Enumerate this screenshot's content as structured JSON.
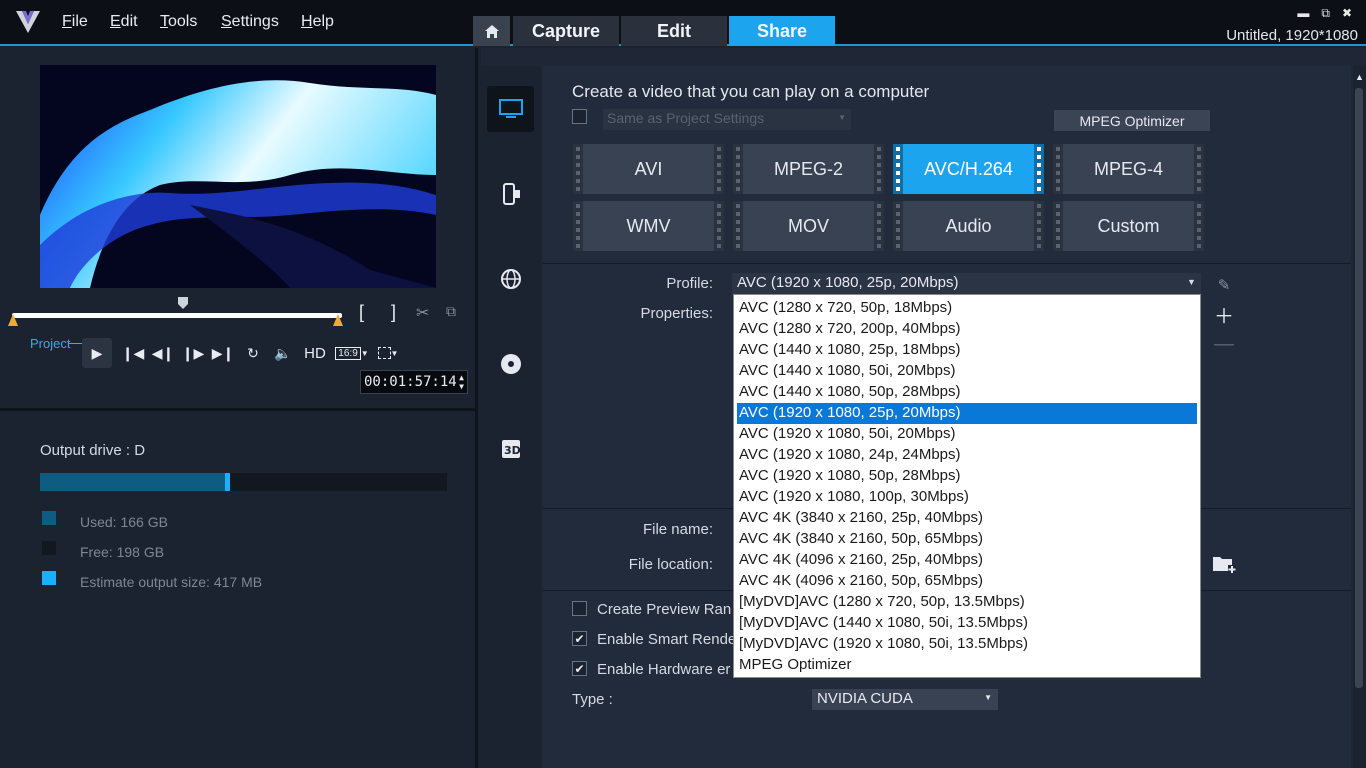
{
  "menu": [
    {
      "label": "File",
      "underline": "F",
      "rest": "ile"
    },
    {
      "label": "Edit",
      "underline": "E",
      "rest": "dit"
    },
    {
      "label": "Tools",
      "underline": "T",
      "rest": "ools"
    },
    {
      "label": "Settings",
      "underline": "S",
      "rest": "ettings"
    },
    {
      "label": "Help",
      "underline": "H",
      "rest": "elp"
    }
  ],
  "tabs": {
    "capture": "Capture",
    "edit": "Edit",
    "share": "Share"
  },
  "project_info": "Untitled, 1920*1080",
  "player": {
    "project_label": "Project",
    "hd_label": "HD",
    "aspect_label": "16:9",
    "timecode": "00:01:57:14",
    "trim_in": "[",
    "trim_out": "]"
  },
  "output": {
    "drive_label": "Output drive : D",
    "used_label": "Used:  166 GB",
    "free_label": "Free:  198 GB",
    "estimate_label": "Estimate output size:  417 MB",
    "used_fraction": 0.456,
    "colors": {
      "used": "#0e5c82",
      "free": "#121720",
      "estimate": "#1ab0ff"
    }
  },
  "share": {
    "title": "Create a video that you can play on a computer",
    "same_as_project": "Same as Project Settings",
    "mpeg_optimizer_btn": "MPEG Optimizer",
    "formats": [
      "AVI",
      "MPEG-2",
      "AVC/H.264",
      "MPEG-4",
      "WMV",
      "MOV",
      "Audio",
      "Custom"
    ],
    "active_format": "AVC/H.264",
    "profile_label": "Profile:",
    "profile_value": "AVC (1920 x 1080, 25p, 20Mbps)",
    "properties_label": "Properties:",
    "file_name_label": "File name:",
    "file_location_label": "File location:",
    "create_preview_label": "Create Preview Ran",
    "smart_render_label": "Enable Smart Rende",
    "hardware_label": "Enable Hardware er",
    "type_label": "Type :",
    "type_value": "NVIDIA CUDA"
  },
  "profile_options": [
    "AVC (1280 x 720, 50p, 18Mbps)",
    "AVC (1280 x 720, 200p, 40Mbps)",
    "AVC (1440 x 1080, 25p, 18Mbps)",
    "AVC (1440 x 1080, 50i, 20Mbps)",
    "AVC (1440 x 1080, 50p, 28Mbps)",
    "AVC (1920 x 1080, 25p, 20Mbps)",
    "AVC (1920 x 1080, 50i, 20Mbps)",
    "AVC (1920 x 1080, 24p, 24Mbps)",
    "AVC (1920 x 1080, 50p, 28Mbps)",
    "AVC (1920 x 1080, 100p, 30Mbps)",
    "AVC 4K (3840 x 2160, 25p, 40Mbps)",
    "AVC 4K (3840 x 2160, 50p, 65Mbps)",
    "AVC 4K (4096 x 2160, 25p, 40Mbps)",
    "AVC 4K (4096 x 2160, 50p, 65Mbps)",
    "[MyDVD]AVC (1280 x 720, 50p, 13.5Mbps)",
    "[MyDVD]AVC (1440 x 1080, 50i, 13.5Mbps)",
    "[MyDVD]AVC (1920 x 1080, 50i, 13.5Mbps)",
    "MPEG Optimizer"
  ],
  "selected_profile_index": 5,
  "accent_color": "#1ca4ee"
}
